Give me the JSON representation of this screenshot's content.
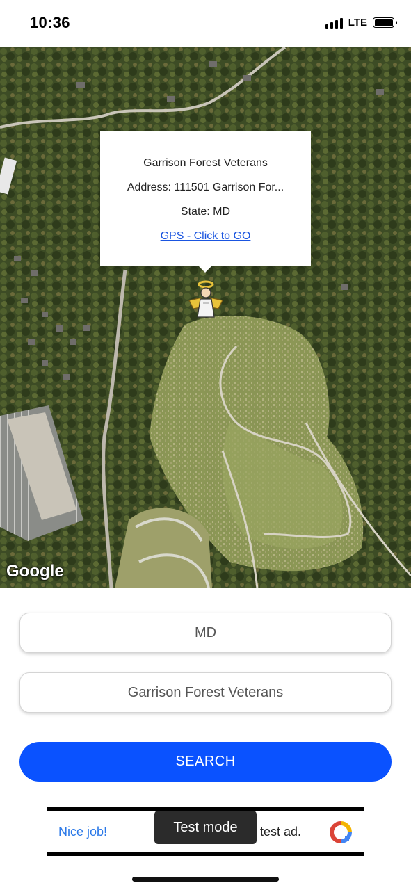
{
  "status_bar": {
    "time": "10:36",
    "network": "LTE",
    "icons": [
      "signal-icon",
      "battery-icon"
    ]
  },
  "map": {
    "attribution": "Google",
    "marker_icon": "angel-marker-icon",
    "info_window": {
      "name": "Garrison Forest Veterans",
      "address": "Address: 111501 Garrison For...",
      "state": "State: MD",
      "gps_link": "GPS - Click to GO"
    }
  },
  "form": {
    "state_value": "MD",
    "cemetery_value": "Garrison Forest Veterans",
    "search_label": "SEARCH"
  },
  "ad": {
    "left_text": "Nice job!",
    "right_text": "test ad.",
    "test_mode_label": "Test mode",
    "icon": "ad-brand-icon"
  },
  "colors": {
    "search_button": "#0a52ff",
    "link": "#1a55e0",
    "ad_text": "#2a78e8"
  }
}
